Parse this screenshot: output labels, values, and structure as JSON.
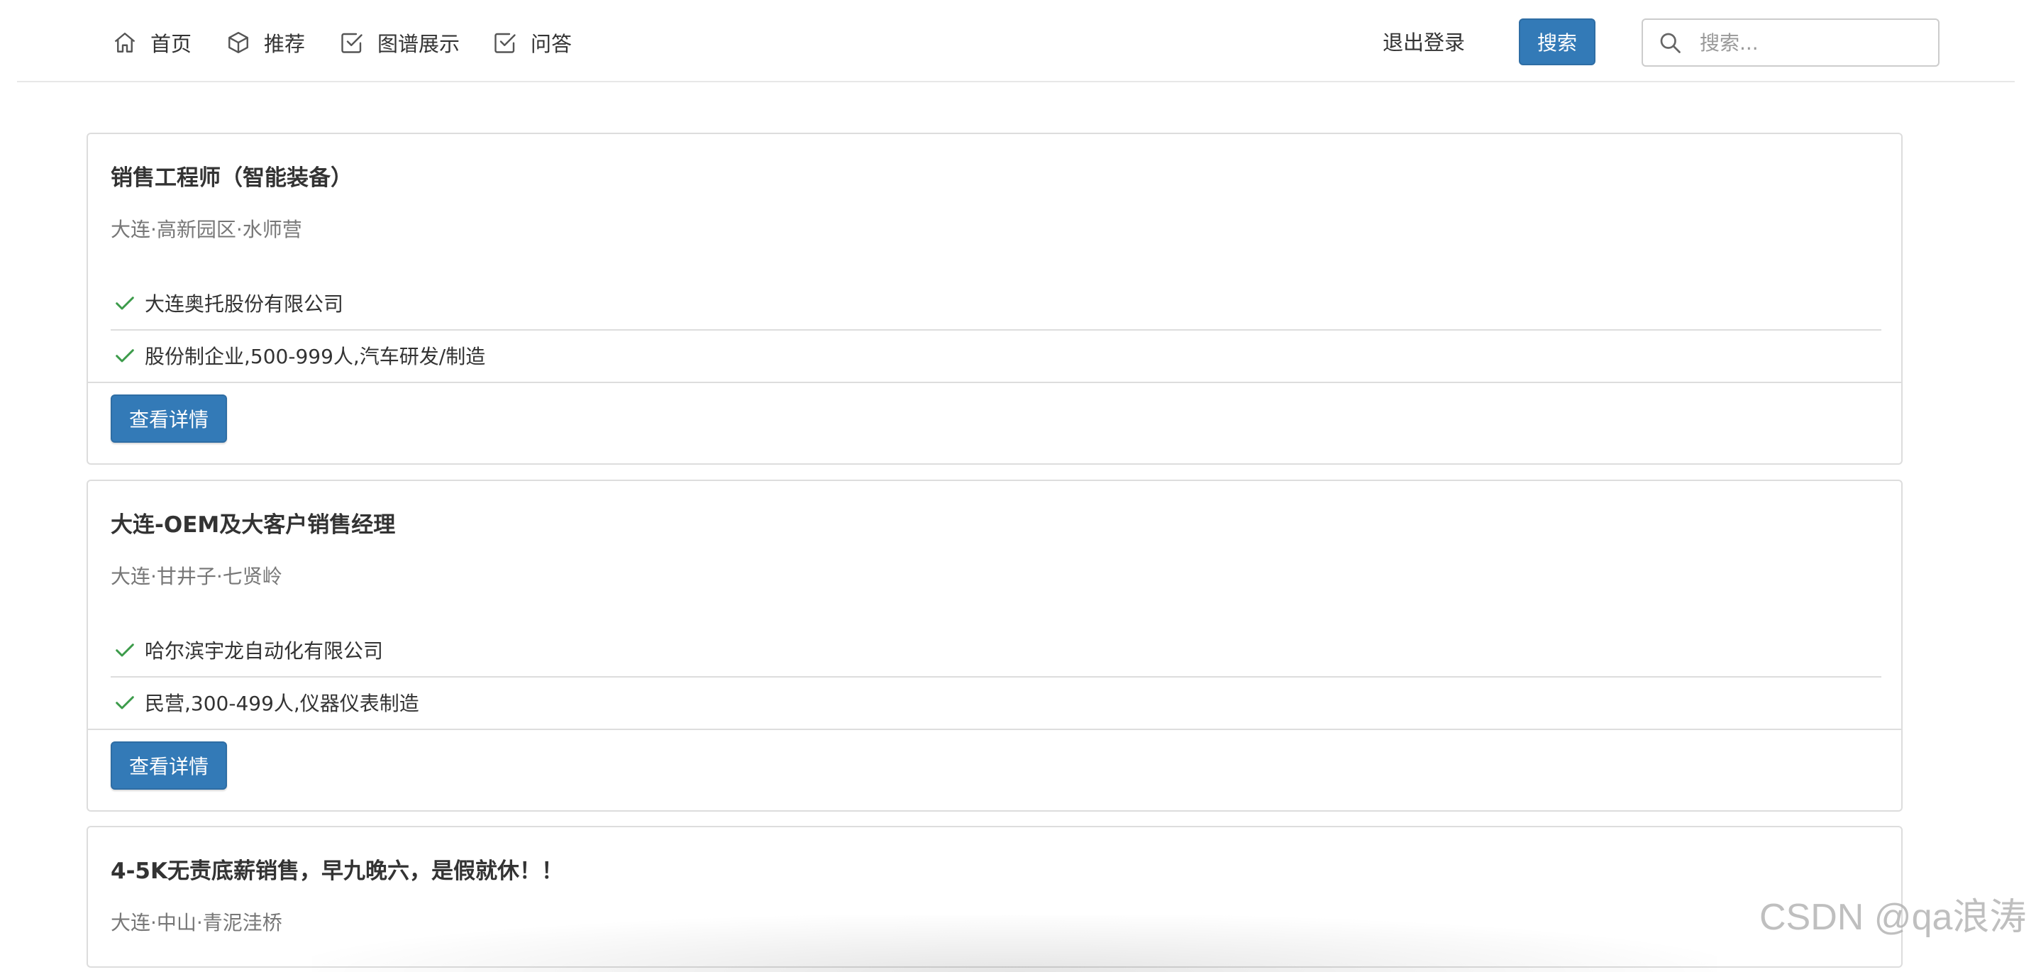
{
  "nav": {
    "items": [
      {
        "label": "首页",
        "icon": "home-icon"
      },
      {
        "label": "推荐",
        "icon": "cube-icon"
      },
      {
        "label": "图谱展示",
        "icon": "check-square-icon"
      },
      {
        "label": "问答",
        "icon": "check-square-icon"
      }
    ],
    "logout_label": "退出登录",
    "search_button_label": "搜索",
    "search_placeholder": "搜索...",
    "search_value": ""
  },
  "jobs": [
    {
      "title": "销售工程师（智能装备）",
      "location": "大连·高新园区·水师营",
      "company": "大连奥托股份有限公司",
      "company_info": "股份制企业,500-999人,汽车研发/制造",
      "button_label": "查看详情"
    },
    {
      "title": "大连-OEM及大客户销售经理",
      "location": "大连·甘井子·七贤岭",
      "company": "哈尔滨宇龙自动化有限公司",
      "company_info": "民营,300-499人,仪器仪表制造",
      "button_label": "查看详情"
    },
    {
      "title": "4-5K无责底薪销售，早九晚六，是假就休！！",
      "location": "大连·中山·青泥洼桥"
    }
  ],
  "colors": {
    "primary": "#337ab7",
    "check": "#3c9b4a",
    "border": "#dddddd",
    "muted_text": "#777777"
  },
  "watermark": "CSDN @qa浪涛"
}
